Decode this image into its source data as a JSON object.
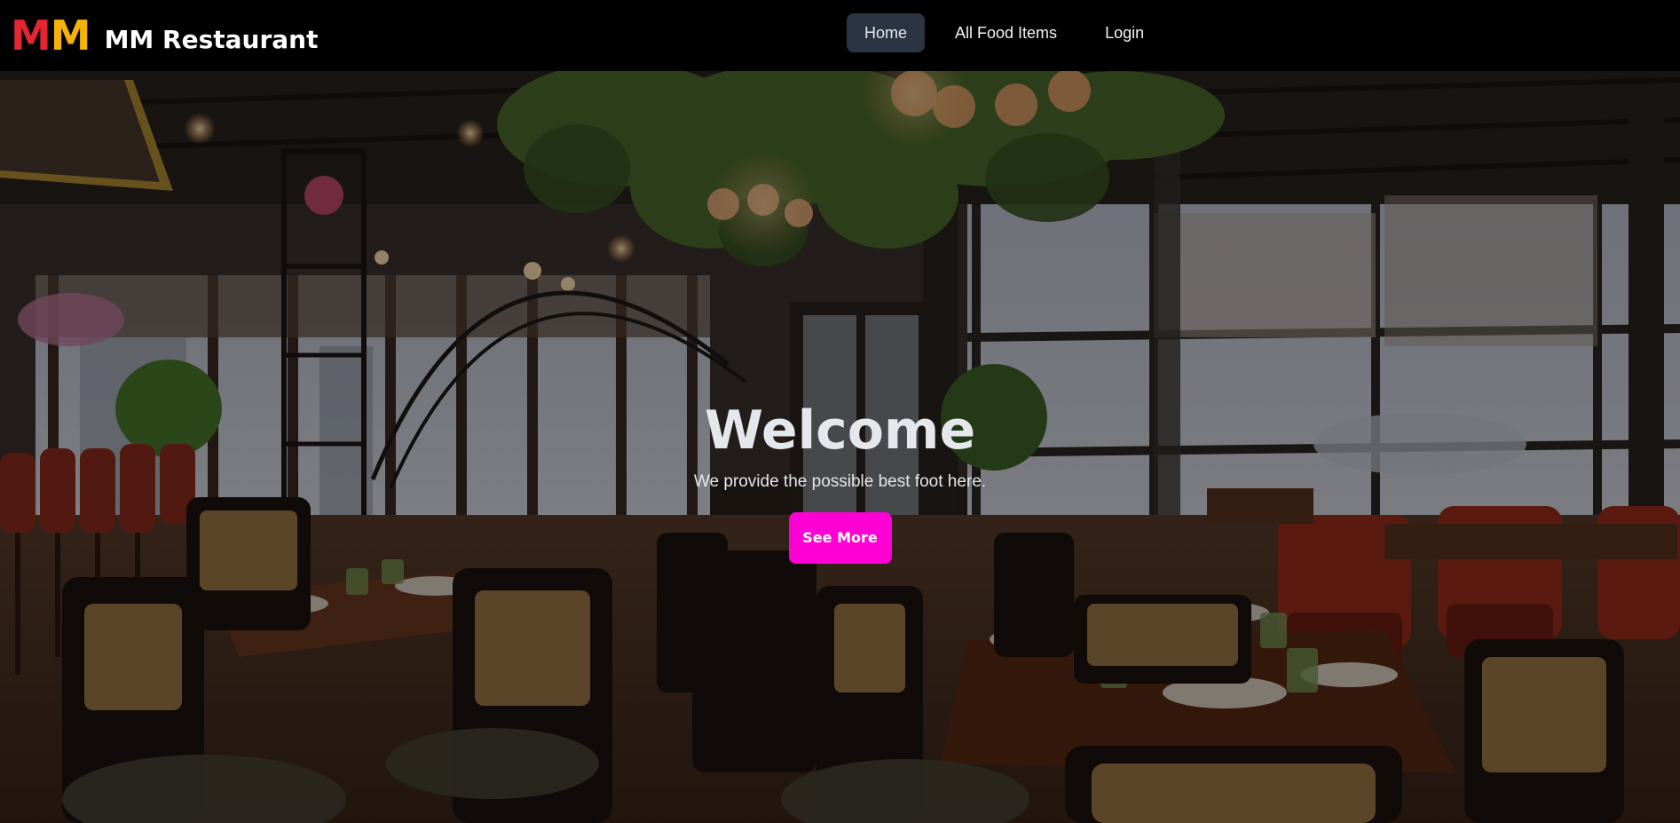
{
  "brand": {
    "initial_1": "M",
    "initial_2": "M",
    "name": "MM Restaurant",
    "colors": {
      "initial_1": "#e3262f",
      "initial_2": "#f5b20d"
    }
  },
  "nav": {
    "items": [
      {
        "label": "Home",
        "active": true
      },
      {
        "label": "All Food Items",
        "active": false
      },
      {
        "label": "Login",
        "active": false
      }
    ]
  },
  "hero": {
    "background_image": "restaurant-interior-photo",
    "title": "Welcome",
    "subtitle": "We provide the possible best foot here.",
    "button_label": "See More",
    "button_color": "#ff00d4"
  }
}
